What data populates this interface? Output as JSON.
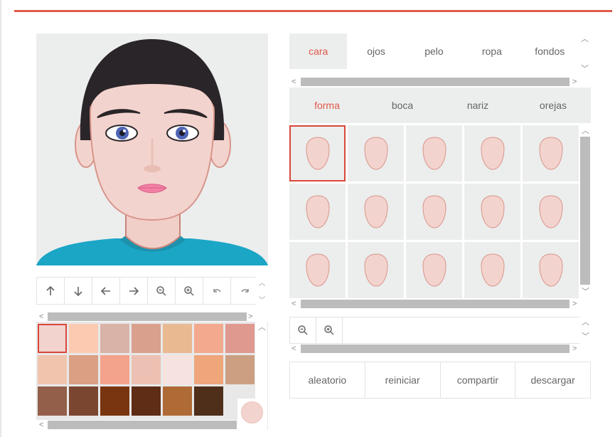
{
  "main_tabs": [
    {
      "label": "cara",
      "active": true
    },
    {
      "label": "ojos",
      "active": false
    },
    {
      "label": "pelo",
      "active": false
    },
    {
      "label": "ropa",
      "active": false
    },
    {
      "label": "fondos",
      "active": false
    }
  ],
  "sub_tabs": [
    {
      "label": "forma",
      "active": true
    },
    {
      "label": "boca",
      "active": false
    },
    {
      "label": "nariz",
      "active": false
    },
    {
      "label": "orejas",
      "active": false
    }
  ],
  "toolbar_icons": [
    "arrow-up-icon",
    "arrow-down-icon",
    "arrow-left-icon",
    "arrow-right-icon",
    "zoom-out-icon",
    "zoom-in-icon",
    "undo-icon",
    "redo-icon"
  ],
  "zoom_icons": [
    "zoom-out-icon",
    "zoom-in-icon"
  ],
  "skin_colors": [
    "#f3d3cd",
    "#fccab1",
    "#d9b3a7",
    "#d9a08e",
    "#e9b992",
    "#f2a98d",
    "#e0998f",
    "#f0c4ad",
    "#d9a083",
    "#f3a28c",
    "#ecc1b3",
    "#f6e3e0",
    "#efa67a",
    "#cc9f82",
    "#935f4a",
    "#7b4630",
    "#79350f",
    "#5f2c15",
    "#b06a35",
    "#4f2f1a"
  ],
  "selected_skin_color": "#f3d3cd",
  "face_shape_count": 15,
  "selected_face_shape": 0,
  "actions": [
    {
      "label": "aleatorio"
    },
    {
      "label": "reiniciar"
    },
    {
      "label": "compartir"
    },
    {
      "label": "descargar"
    }
  ],
  "colors": {
    "accent": "#e05a4b",
    "panel_bg": "#eceded",
    "skin": "#f3d3cd",
    "skin_outline": "#d8958a",
    "hair": "#2a2528",
    "shirt": "#1ba6c6",
    "eyes": "#4f65b5"
  }
}
